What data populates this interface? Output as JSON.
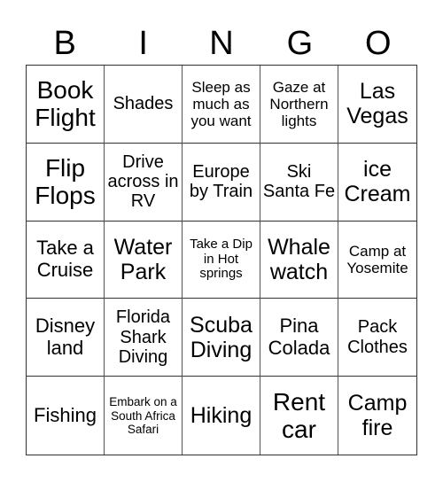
{
  "header": {
    "letters": [
      "B",
      "I",
      "N",
      "G",
      "O"
    ]
  },
  "cells": [
    {
      "text": "Book Flight",
      "size": "s-xl"
    },
    {
      "text": "Shades",
      "size": "s-sm"
    },
    {
      "text": "Sleep as much as you want",
      "size": "s-xs"
    },
    {
      "text": "Gaze at Northern lights",
      "size": "s-xs"
    },
    {
      "text": "Las Vegas",
      "size": "s-lg"
    },
    {
      "text": "Flip Flops",
      "size": "s-xl"
    },
    {
      "text": "Drive across in RV",
      "size": "s-sm"
    },
    {
      "text": "Europe by Train",
      "size": "s-sm"
    },
    {
      "text": "Ski Santa Fe",
      "size": "s-sm"
    },
    {
      "text": "ice Cream",
      "size": "s-lg"
    },
    {
      "text": "Take a Cruise",
      "size": "s-md"
    },
    {
      "text": "Water Park",
      "size": "s-lg"
    },
    {
      "text": "Take a Dip in Hot springs",
      "size": "s-xxs"
    },
    {
      "text": "Whale watch",
      "size": "s-lg"
    },
    {
      "text": "Camp at Yosemite",
      "size": "s-xs"
    },
    {
      "text": "Disney land",
      "size": "s-md"
    },
    {
      "text": "Florida Shark Diving",
      "size": "s-sm"
    },
    {
      "text": "Scuba Diving",
      "size": "s-lg"
    },
    {
      "text": "Pina Colada",
      "size": "s-md"
    },
    {
      "text": "Pack Clothes",
      "size": "s-sm"
    },
    {
      "text": "Fishing",
      "size": "s-md"
    },
    {
      "text": "Embark on a South Africa Safari",
      "size": "s-tiny"
    },
    {
      "text": "Hiking",
      "size": "s-lg"
    },
    {
      "text": "Rent car",
      "size": "s-xl"
    },
    {
      "text": "Camp fire",
      "size": "s-lg"
    }
  ]
}
